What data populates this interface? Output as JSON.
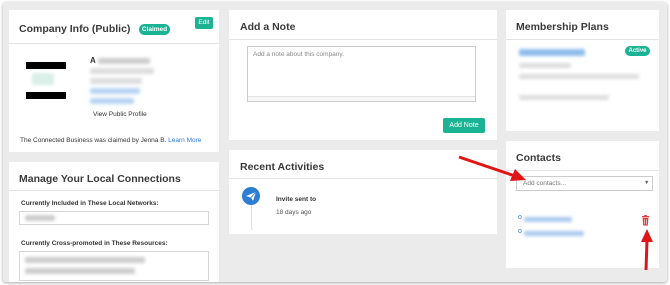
{
  "company_info": {
    "title": "Company Info (Public)",
    "claimed_badge": "Claimed",
    "edit_label": "Edit",
    "profile_initial": "A",
    "view_public_profile": "View Public Profile",
    "claimed_text": "The Connected Business was claimed by Jenna B.",
    "learn_more": "Learn More"
  },
  "local_connections": {
    "title": "Manage Your Local Connections",
    "included_label": "Currently Included in These Local Networks:",
    "crosspromoted_label": "Currently Cross-promoted in These Resources:"
  },
  "add_note": {
    "title": "Add a Note",
    "placeholder": "Add a note about this company.",
    "button_label": "Add Note"
  },
  "recent_activities": {
    "title": "Recent Activities",
    "items": [
      {
        "text": "Invite sent to",
        "time": "18 days ago",
        "icon": "paper-plane-icon"
      }
    ]
  },
  "membership_plans": {
    "title": "Membership Plans",
    "status_badge": "Active"
  },
  "contacts": {
    "title": "Contacts",
    "select_placeholder": "Add contacts...",
    "item_prefixes": [
      "o",
      "o"
    ],
    "delete_icon": "trash-icon"
  },
  "colors": {
    "accent": "#1ab394",
    "link": "#2a7ad2",
    "arrow": "#e01515",
    "timeline_icon": "#2d7dd2"
  }
}
